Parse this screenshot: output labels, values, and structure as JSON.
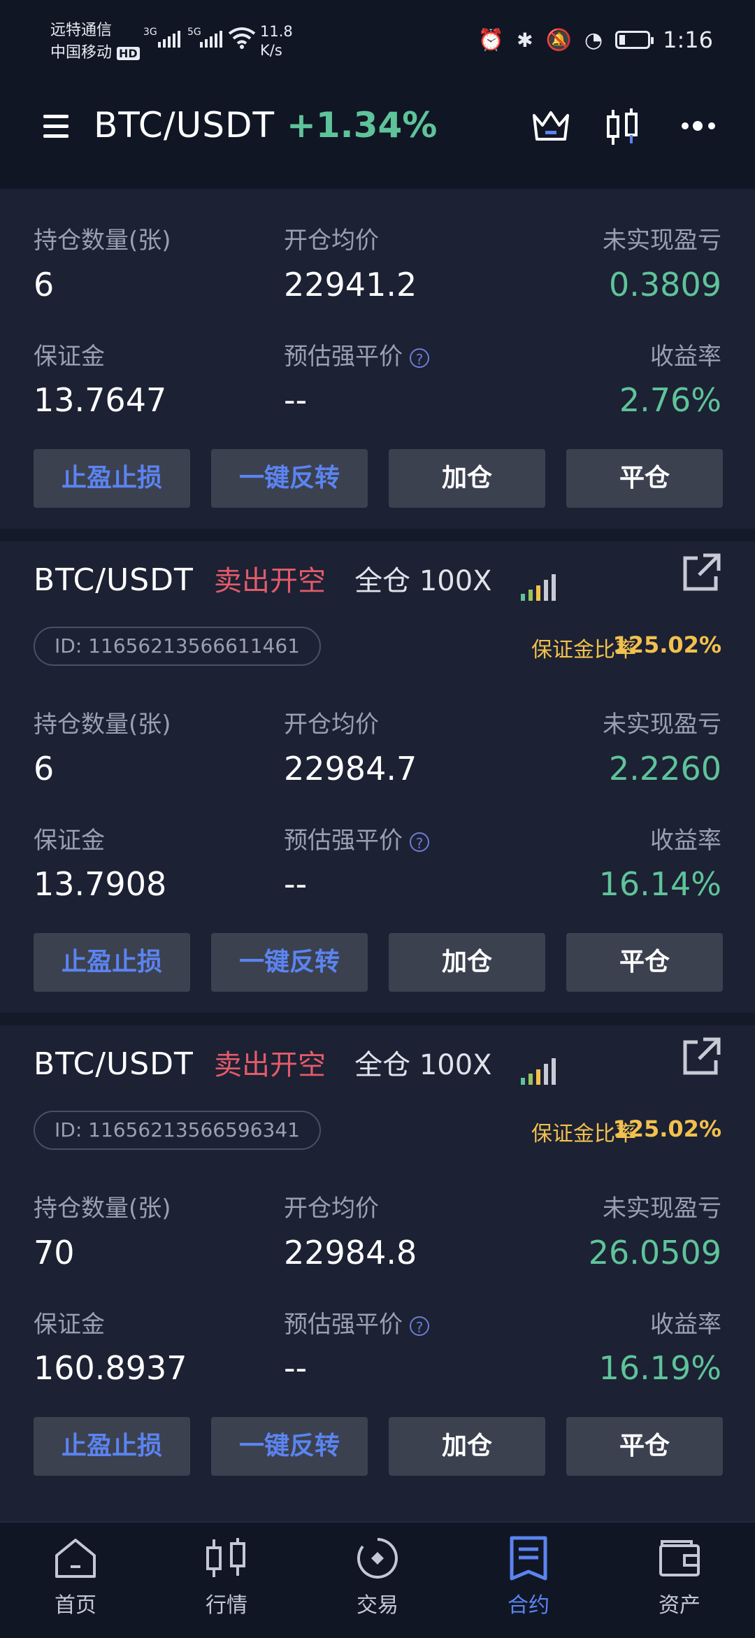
{
  "status_bar": {
    "carrier1": "远特通信",
    "carrier2": "中国移动",
    "hd_badge": "HD",
    "net1": "3G",
    "net2": "5G",
    "speed_value": "11.8",
    "speed_unit": "K/s",
    "time": "1:16"
  },
  "header": {
    "pair": "BTC/USDT",
    "change": "+1.34%"
  },
  "labels": {
    "qty": "持仓数量(张)",
    "avg_price": "开仓均价",
    "unrealized": "未实现盈亏",
    "margin": "保证金",
    "liq_price": "预估强平价",
    "roi": "收益率",
    "ratio": "保证金比率",
    "help": "?"
  },
  "buttons": {
    "tp_sl": "止盈止损",
    "reverse": "一键反转",
    "add": "加仓",
    "close": "平仓"
  },
  "positions": [
    {
      "qty": "6",
      "avg_price": "22941.2",
      "unrealized": "0.3809",
      "margin": "13.7647",
      "liq_price": "--",
      "roi": "2.76%"
    },
    {
      "symbol": "BTC/USDT",
      "side": "卖出开空",
      "mode": "全仓 100X",
      "id": "ID: 11656213566611461",
      "ratio": "125.02%",
      "qty": "6",
      "avg_price": "22984.7",
      "unrealized": "2.2260",
      "margin": "13.7908",
      "liq_price": "--",
      "roi": "16.14%"
    },
    {
      "symbol": "BTC/USDT",
      "side": "卖出开空",
      "mode": "全仓 100X",
      "id": "ID: 11656213566596341",
      "ratio": "125.02%",
      "qty": "70",
      "avg_price": "22984.8",
      "unrealized": "26.0509",
      "margin": "160.8937",
      "liq_price": "--",
      "roi": "16.19%"
    }
  ],
  "nav": {
    "home": "首页",
    "market": "行情",
    "trade": "交易",
    "contract": "合约",
    "assets": "资产"
  },
  "colors": {
    "accent": "#5b84f0",
    "positive": "#5fc39a",
    "short": "#e25b6a",
    "warning": "#f2c14d"
  }
}
